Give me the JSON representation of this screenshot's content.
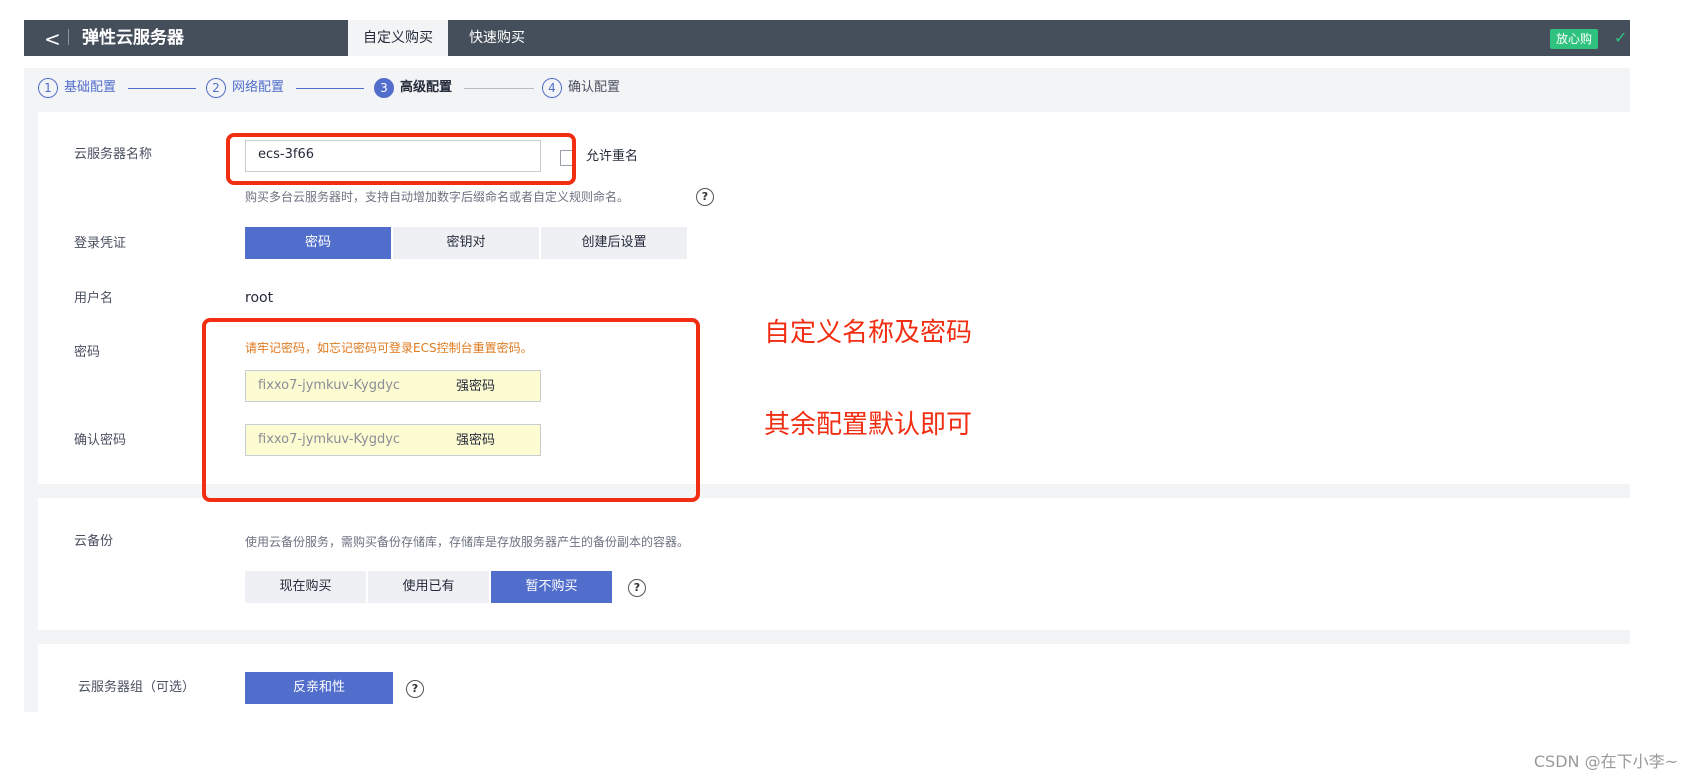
{
  "header": {
    "back_glyph": "<",
    "title": "弹性云服务器",
    "tabs": [
      "自定义购买",
      "快速购买"
    ],
    "badge": "放心购",
    "check_glyph": "✓"
  },
  "steps": [
    {
      "num": "1",
      "label": "基础配置"
    },
    {
      "num": "2",
      "label": "网络配置"
    },
    {
      "num": "3",
      "label": "高级配置"
    },
    {
      "num": "4",
      "label": "确认配置"
    }
  ],
  "form": {
    "name_label": "云服务器名称",
    "name_value": "ecs-3f66",
    "allow_dup_label": "允许重名",
    "name_hint": "购买多台云服务器时，支持自动增加数字后缀命名或者自定义规则命名。",
    "help_glyph": "?",
    "login_label": "登录凭证",
    "login_options": [
      "密码",
      "密钥对",
      "创建后设置"
    ],
    "username_label": "用户名",
    "username_value": "root",
    "password_label": "密码",
    "password_warning": "请牢记密码，如忘记密码可登录ECS控制台重置密码。",
    "password_value": "fixxo7-jymkuv-Kygdyc",
    "password_strength": "强密码",
    "confirm_label": "确认密码",
    "confirm_value": "fixxo7-jymkuv-Kygdyc",
    "confirm_strength": "强密码"
  },
  "backup": {
    "label": "云备份",
    "hint": "使用云备份服务，需购买备份存储库，存储库是存放服务器产生的备份副本的容器。",
    "options": [
      "现在购买",
      "使用已有",
      "暂不购买"
    ]
  },
  "group": {
    "label": "云服务器组（可选）",
    "option": "反亲和性"
  },
  "annotations": {
    "a1": "自定义名称及密码",
    "a2": "其余配置默认即可"
  },
  "watermark": "CSDN @在下小李~",
  "colors": {
    "accent": "#526ecc",
    "annotation": "#f12d12",
    "badge": "#2ec27e",
    "header": "#454f5b"
  }
}
